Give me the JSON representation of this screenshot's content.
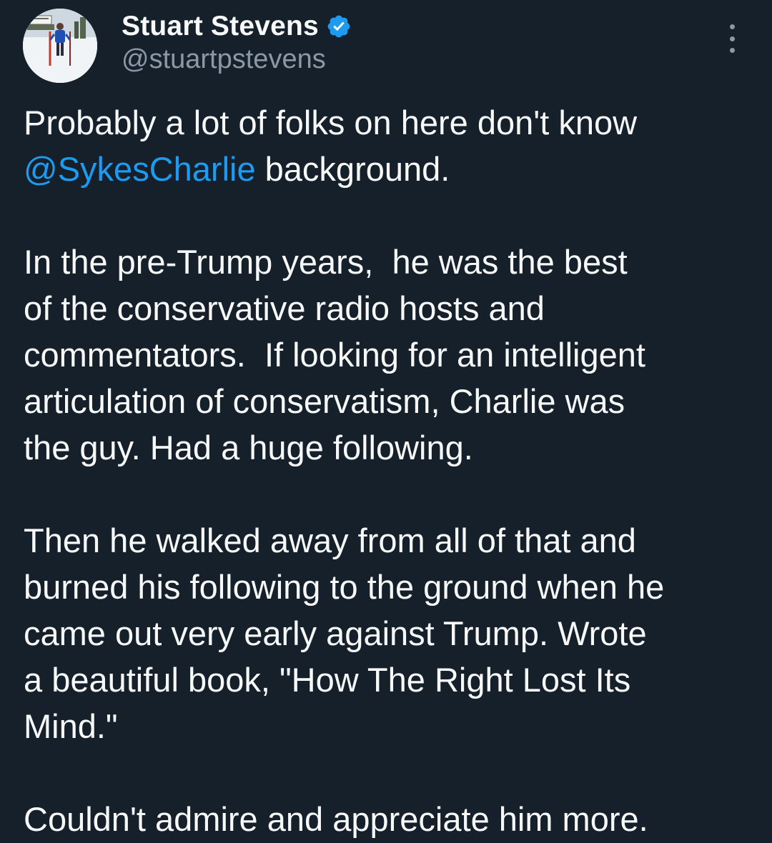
{
  "author": {
    "display_name": "Stuart Stevens",
    "handle": "@stuartpstevens",
    "verified": true,
    "avatar_icon": "profile-photo-skier-in-snow",
    "verified_icon": "verified-badge-icon"
  },
  "menu_icon": "more-options-icon",
  "tweet": {
    "p1_prefix": "Probably a lot of folks on here don't know",
    "p1_mention": "@SykesCharlie",
    "p1_suffix": " background.",
    "p2_line1": "In the pre-Trump years,  he was the best",
    "p2_line2": "of the conservative radio hosts and",
    "p2_line3": "commentators.  If looking for an intelligent",
    "p2_line4": "articulation of conservatism, Charlie was",
    "p2_line5": "the guy. Had a huge following.",
    "p3_line1": "Then he walked away from all of that and",
    "p3_line2": "burned his following to the ground when he",
    "p3_line3": "came out very early against Trump. Wrote",
    "p3_line4": "a beautiful book, \"How The Right Lost Its",
    "p3_line5": "Mind.\"",
    "p4_line1": "Couldn't admire and appreciate him more."
  },
  "colors": {
    "background": "#15202b",
    "text": "#f7f9f9",
    "secondary_text": "#8b98a5",
    "link": "#1d9bf0",
    "verified": "#1d9bf0"
  }
}
